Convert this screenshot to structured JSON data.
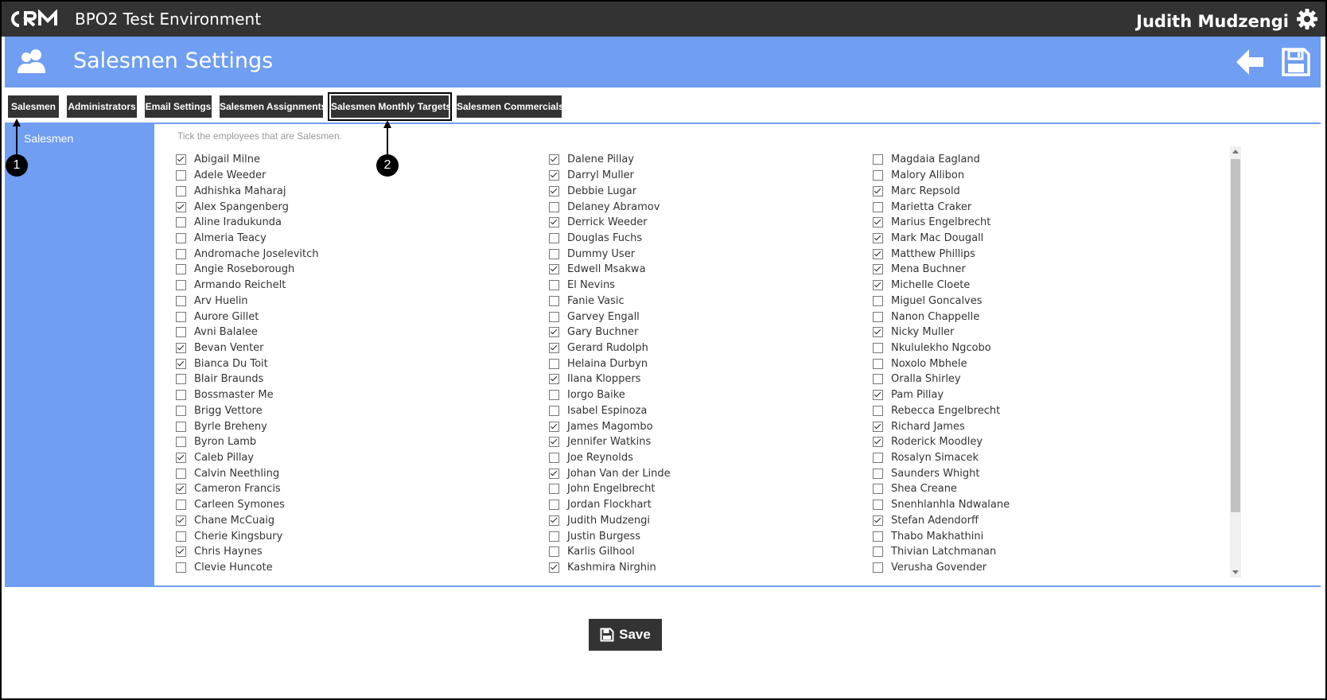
{
  "app": {
    "environment_title": "BPO2 Test Environment",
    "user_name": "Judith Mudzengi"
  },
  "header": {
    "page_title": "Salesmen Settings"
  },
  "tabs": [
    {
      "label": "Salesmen"
    },
    {
      "label": "Administrators"
    },
    {
      "label": "Email Settings"
    },
    {
      "label": "Salesmen Assignments"
    },
    {
      "label": "Salesmen Monthly Targets"
    },
    {
      "label": "Salesmen Commercials"
    }
  ],
  "sidebar": {
    "item": "Salesmen"
  },
  "instructions": "Tick the employees that are Salesmen.",
  "columns": [
    [
      {
        "name": "Abigail Milne",
        "checked": true
      },
      {
        "name": "Adele Weeder",
        "checked": false
      },
      {
        "name": "Adhishka Maharaj",
        "checked": false
      },
      {
        "name": "Alex Spangenberg",
        "checked": true
      },
      {
        "name": "Aline Iradukunda",
        "checked": false
      },
      {
        "name": "Almeria Teacy",
        "checked": false
      },
      {
        "name": "Andromache Joselevitch",
        "checked": false
      },
      {
        "name": "Angie Roseborough",
        "checked": false
      },
      {
        "name": "Armando Reichelt",
        "checked": false
      },
      {
        "name": "Arv Huelin",
        "checked": false
      },
      {
        "name": "Aurore Gillet",
        "checked": false
      },
      {
        "name": "Avni Balalee",
        "checked": false
      },
      {
        "name": "Bevan Venter",
        "checked": true
      },
      {
        "name": "Bianca Du Toit",
        "checked": true
      },
      {
        "name": "Blair Braunds",
        "checked": false
      },
      {
        "name": "Bossmaster Me",
        "checked": false
      },
      {
        "name": "Brigg Vettore",
        "checked": false
      },
      {
        "name": "Byrle Breheny",
        "checked": false
      },
      {
        "name": "Byron Lamb",
        "checked": false
      },
      {
        "name": "Caleb Pillay",
        "checked": true
      },
      {
        "name": "Calvin Neethling",
        "checked": false
      },
      {
        "name": "Cameron Francis",
        "checked": true
      },
      {
        "name": "Carleen Symones",
        "checked": false
      },
      {
        "name": "Chane McCuaig",
        "checked": true
      },
      {
        "name": "Cherie Kingsbury",
        "checked": false
      },
      {
        "name": "Chris Haynes",
        "checked": true
      },
      {
        "name": "Clevie Huncote",
        "checked": false
      }
    ],
    [
      {
        "name": "Dalene Pillay",
        "checked": true
      },
      {
        "name": "Darryl Muller",
        "checked": true
      },
      {
        "name": "Debbie Lugar",
        "checked": true
      },
      {
        "name": "Delaney Abramov",
        "checked": false
      },
      {
        "name": "Derrick Weeder",
        "checked": true
      },
      {
        "name": "Douglas Fuchs",
        "checked": false
      },
      {
        "name": "Dummy User",
        "checked": false
      },
      {
        "name": "Edwell Msakwa",
        "checked": true
      },
      {
        "name": "El Nevins",
        "checked": false
      },
      {
        "name": "Fanie Vasic",
        "checked": false
      },
      {
        "name": "Garvey Engall",
        "checked": false
      },
      {
        "name": "Gary Buchner",
        "checked": true
      },
      {
        "name": "Gerard Rudolph",
        "checked": true
      },
      {
        "name": "Helaina Durbyn",
        "checked": false
      },
      {
        "name": "Ilana Kloppers",
        "checked": true
      },
      {
        "name": "Iorgo Baike",
        "checked": false
      },
      {
        "name": "Isabel Espinoza",
        "checked": false
      },
      {
        "name": "James Magombo",
        "checked": true
      },
      {
        "name": "Jennifer Watkins",
        "checked": true
      },
      {
        "name": "Joe Reynolds",
        "checked": false
      },
      {
        "name": "Johan Van der Linde",
        "checked": true
      },
      {
        "name": "John Engelbrecht",
        "checked": false
      },
      {
        "name": "Jordan Flockhart",
        "checked": false
      },
      {
        "name": "Judith Mudzengi",
        "checked": true
      },
      {
        "name": "Justin Burgess",
        "checked": false
      },
      {
        "name": "Karlis Gilhool",
        "checked": false
      },
      {
        "name": "Kashmira Nirghin",
        "checked": true
      }
    ],
    [
      {
        "name": "Magdaia Eagland",
        "checked": false
      },
      {
        "name": "Malory Allibon",
        "checked": false
      },
      {
        "name": "Marc Repsold",
        "checked": true
      },
      {
        "name": "Marietta Craker",
        "checked": false
      },
      {
        "name": "Marius Engelbrecht",
        "checked": true
      },
      {
        "name": "Mark Mac Dougall",
        "checked": true
      },
      {
        "name": "Matthew Phillips",
        "checked": true
      },
      {
        "name": "Mena Buchner",
        "checked": true
      },
      {
        "name": "Michelle Cloete",
        "checked": true
      },
      {
        "name": "Miguel Goncalves",
        "checked": false
      },
      {
        "name": "Nanon Chappelle",
        "checked": false
      },
      {
        "name": "Nicky Muller",
        "checked": true
      },
      {
        "name": "Nkululekho Ngcobo",
        "checked": false
      },
      {
        "name": "Noxolo Mbhele",
        "checked": false
      },
      {
        "name": "Oralla Shirley",
        "checked": false
      },
      {
        "name": "Pam Pillay",
        "checked": true
      },
      {
        "name": "Rebecca Engelbrecht",
        "checked": false
      },
      {
        "name": "Richard James",
        "checked": true
      },
      {
        "name": "Roderick Moodley",
        "checked": true
      },
      {
        "name": "Rosalyn Simacek",
        "checked": false
      },
      {
        "name": "Saunders Whight",
        "checked": false
      },
      {
        "name": "Shea Creane",
        "checked": false
      },
      {
        "name": "Snenhlanhla Ndwalane",
        "checked": false
      },
      {
        "name": "Stefan Adendorff",
        "checked": true
      },
      {
        "name": "Thabo Makhathini",
        "checked": false
      },
      {
        "name": "Thivian Latchmanan",
        "checked": false
      },
      {
        "name": "Verusha Govender",
        "checked": false
      }
    ]
  ],
  "footer": {
    "save_label": "Save"
  },
  "callouts": {
    "one": "1",
    "two": "2"
  },
  "colors": {
    "accent": "#6f9ef2",
    "dark": "#333333"
  }
}
